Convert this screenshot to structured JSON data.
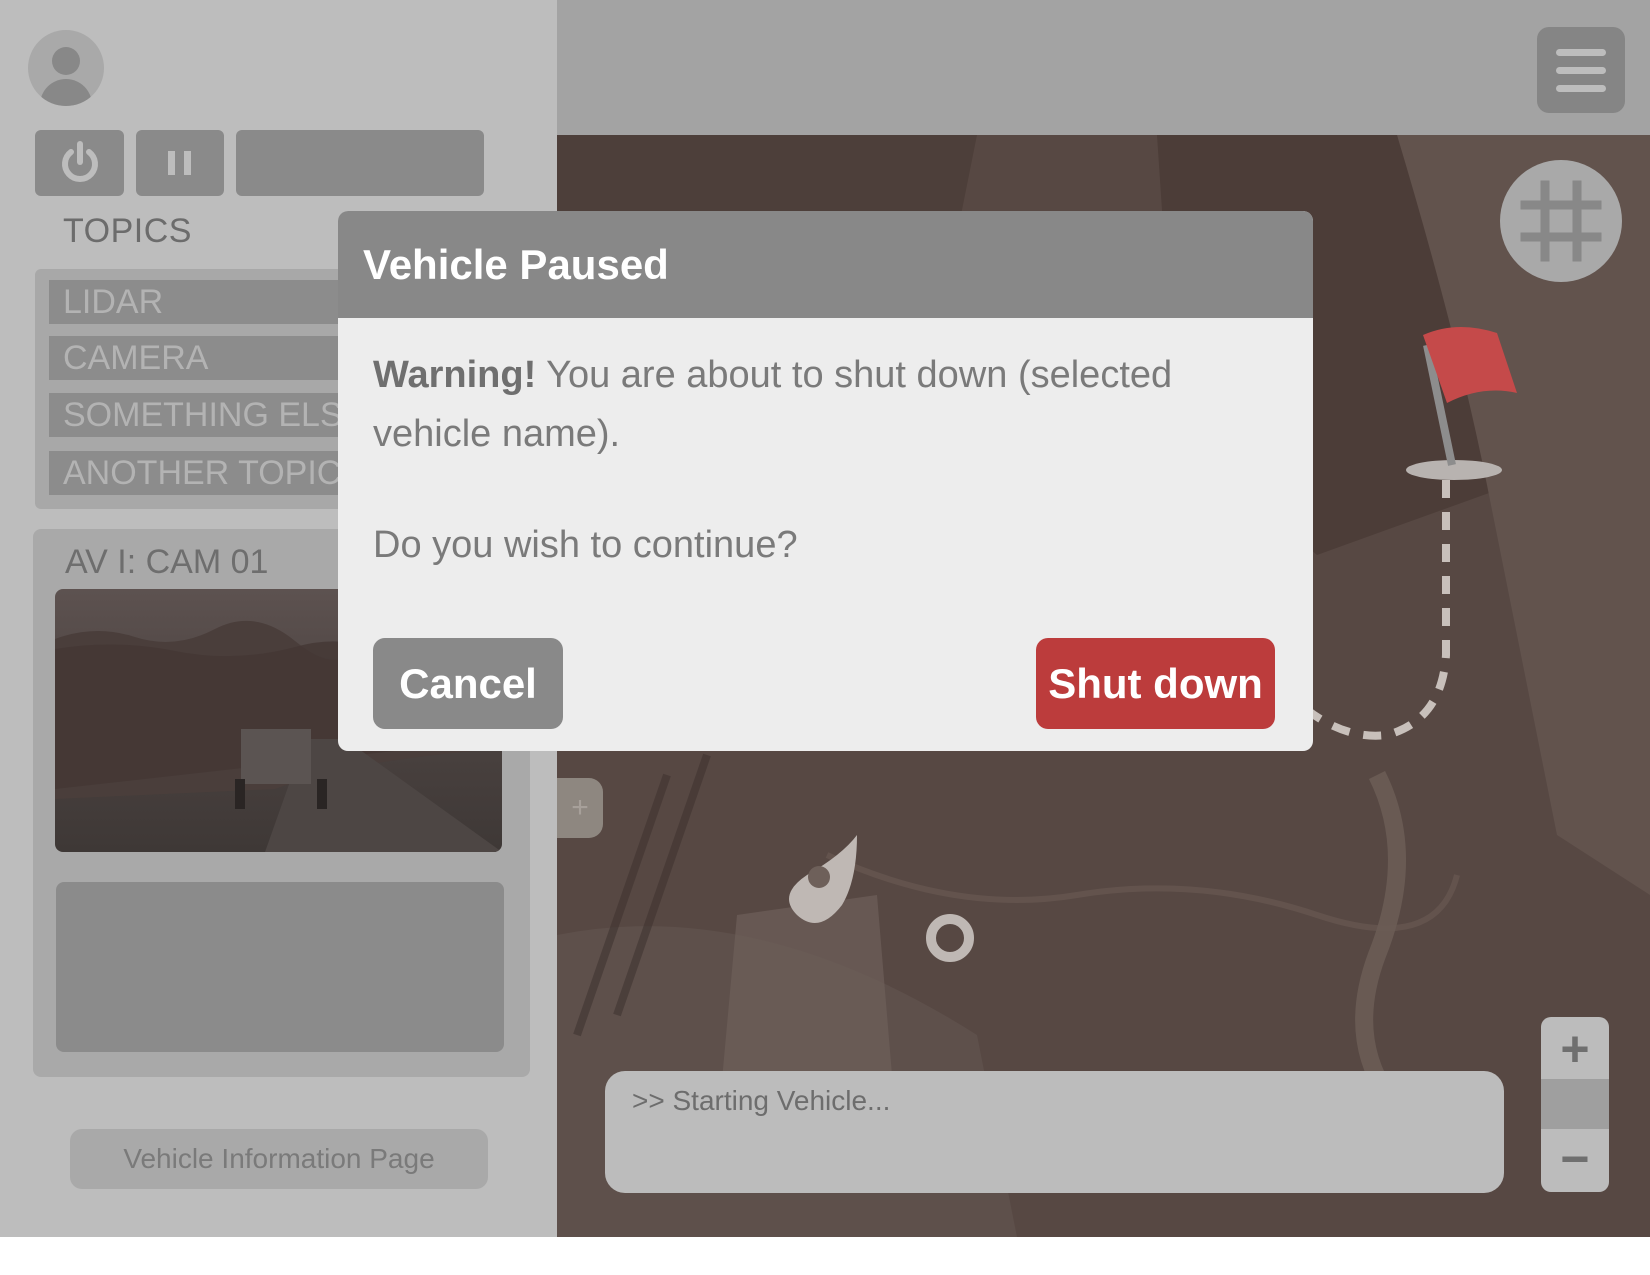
{
  "sidebar": {
    "topics_heading": "TOPICS",
    "topics": [
      "LIDAR",
      "CAMERA",
      "SOMETHING ELSE",
      "ANOTHER TOPIC"
    ],
    "camera_feed_title": "AV I: CAM 01",
    "vehicle_info_button": "Vehicle Information Page"
  },
  "map": {
    "side_tab_label": "+",
    "console_text": ">> Starting Vehicle...",
    "zoom_in": "+",
    "zoom_out": "−"
  },
  "modal": {
    "title": "Vehicle Paused",
    "warning_label": "Warning!",
    "message": " You are about to shut down (selected vehicle name).",
    "question": "Do you wish to continue?",
    "cancel_label": "Cancel",
    "confirm_label": "Shut down"
  },
  "colors": {
    "accent_red": "#bc3c3c",
    "modal_header": "#888888",
    "flag": "#c54a4a"
  },
  "icons": [
    "user-avatar-icon",
    "power-icon",
    "pause-icon",
    "menu-icon",
    "grid-icon",
    "flag-icon",
    "waypoint-pin-icon",
    "waypoint-ring-icon"
  ]
}
